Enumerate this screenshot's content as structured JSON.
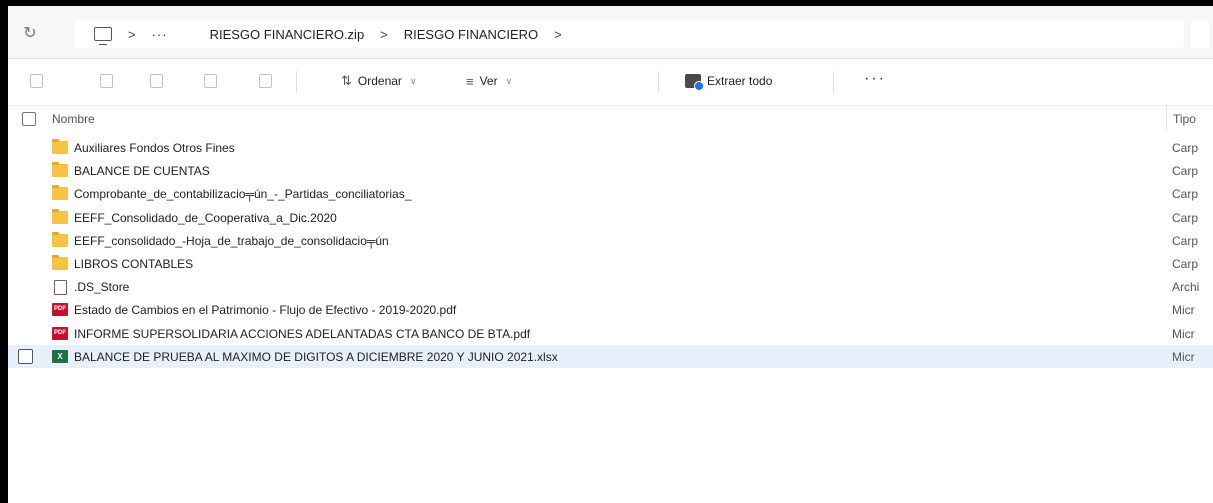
{
  "address_bar": {
    "breadcrumb": [
      "RIESGO FINANCIERO.zip",
      "RIESGO FINANCIERO"
    ],
    "overflow": "···",
    "separator": ">"
  },
  "toolbar": {
    "sort_label": "Ordenar",
    "view_label": "Ver",
    "extract_label": "Extraer todo",
    "more_label": "···"
  },
  "columns": {
    "name": "Nombre",
    "type": "Tipo"
  },
  "files": [
    {
      "name": "Auxiliares Fondos Otros Fines",
      "type": "Carp",
      "icon": "folder-icon"
    },
    {
      "name": "BALANCE DE CUENTAS",
      "type": "Carp",
      "icon": "folder-icon"
    },
    {
      "name": "Comprobante_de_contabilizacio╤ún_-_Partidas_conciliatorias_",
      "type": "Carp",
      "icon": "folder-icon"
    },
    {
      "name": "EEFF_Consolidado_de_Cooperativa_a_Dic.2020",
      "type": "Carp",
      "icon": "folder-icon"
    },
    {
      "name": "EEFF_consolidado_-Hoja_de_trabajo_de_consolidacio╤ún",
      "type": "Carp",
      "icon": "folder-icon"
    },
    {
      "name": "LIBROS CONTABLES",
      "type": "Carp",
      "icon": "folder-icon"
    },
    {
      "name": ".DS_Store",
      "type": "Archi",
      "icon": "file-icon"
    },
    {
      "name": "Estado de Cambios en el Patrimonio - Flujo de Efectivo - 2019-2020.pdf",
      "type": "Micr",
      "icon": "pdf-icon"
    },
    {
      "name": "INFORME SUPERSOLIDARIA ACCIONES ADELANTADAS CTA BANCO DE BTA.pdf",
      "type": "Micr",
      "icon": "pdf-icon"
    },
    {
      "name": "BALANCE DE PRUEBA AL MAXIMO DE DIGITOS A DICIEMBRE 2020 Y JUNIO 2021.xlsx",
      "type": "Micr",
      "icon": "excel-icon",
      "selected": true
    }
  ]
}
